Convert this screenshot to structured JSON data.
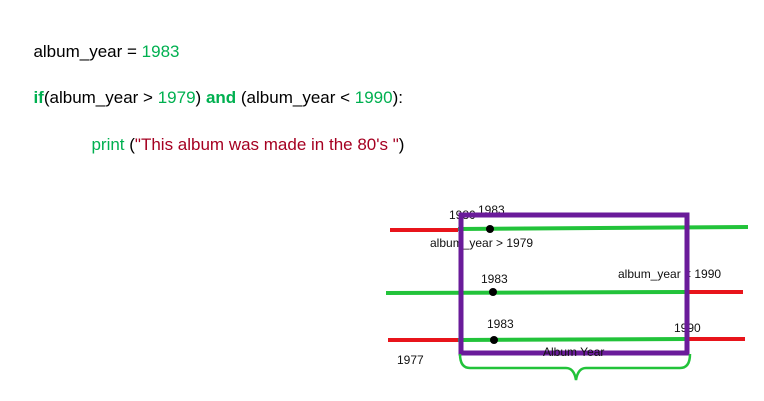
{
  "code": {
    "line1": {
      "var": "album_year = ",
      "value": "1983"
    },
    "line2": {
      "kw_if": "if",
      "cond1_open": "(album_year > ",
      "cond1_num": "1979",
      "cond1_close": ") ",
      "kw_and": "and",
      "cond2_open": " (album_year < ",
      "cond2_num": "1990",
      "cond2_close": "):"
    },
    "line3": {
      "fn": "print",
      "open": " (",
      "string": "\"This album was made in the 80's \"",
      "close": ")"
    }
  },
  "diagram": {
    "colors": {
      "red": "#e8141b",
      "green": "#22c33a",
      "purple": "#6a1b9a",
      "brace": "#22c33a"
    },
    "row1": {
      "tick_label": "1980",
      "point_label": "1983",
      "condition_label": "album_year > 1979"
    },
    "row2": {
      "point_label": "1983",
      "condition_label": "album_year < 1990"
    },
    "row3": {
      "point_label": "1983",
      "end_label": "1990",
      "start_label": "1977",
      "brace_label": "Album Year"
    }
  }
}
